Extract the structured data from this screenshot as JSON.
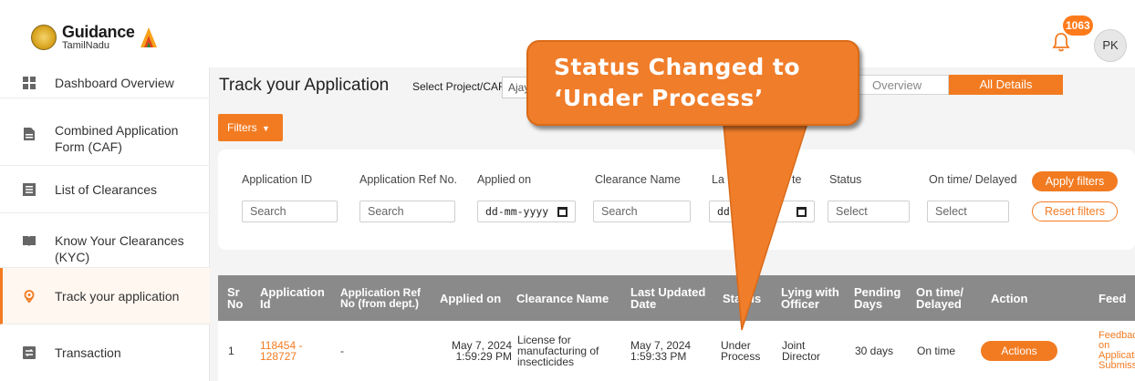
{
  "header": {
    "logo_title": "Guidance",
    "logo_subtitle": "TamilNadu",
    "notification_count": "1063",
    "avatar_initials": "PK"
  },
  "sidebar": {
    "items": [
      {
        "label": "Dashboard Overview",
        "icon": "dashboard-icon"
      },
      {
        "label": "Combined Application Form (CAF)",
        "icon": "document-icon"
      },
      {
        "label": "List of Clearances",
        "icon": "list-icon"
      },
      {
        "label": "Know Your Clearances (KYC)",
        "icon": "book-icon"
      },
      {
        "label": "Track your application",
        "icon": "location-pin-icon",
        "active": true
      },
      {
        "label": "Transaction",
        "icon": "transaction-icon"
      }
    ]
  },
  "main": {
    "title": "Track your Application",
    "select_label": "Select Project/CAF",
    "select_value": "Ajay",
    "tabs": [
      "Overview",
      "All Details"
    ],
    "filters_label": "Filters"
  },
  "filters": {
    "labels": [
      "Application ID",
      "Application Ref No.",
      "Applied on",
      "Clearance Name",
      "La",
      "te",
      "Status",
      "On time/ Delayed"
    ],
    "placeholders": {
      "application_id": "Search",
      "ref_no": "Search",
      "applied_on": "dd-mm-yyyy",
      "clearance_name": "Search",
      "last_updated": "dd",
      "status": "Select",
      "on_time": "Select"
    },
    "apply_label": "Apply filters",
    "reset_label": "Reset filters"
  },
  "table": {
    "headers": [
      "Sr No",
      "Application Id",
      "Application Ref No (from dept.)",
      "Applied on",
      "Clearance Name",
      "Last Updated Date",
      "Sta",
      "us",
      "Lying with Officer",
      "Pending Days",
      "On time/ Delayed",
      "Action",
      "Feed"
    ],
    "row": {
      "sr": "1",
      "app_id": "118454 - 128727",
      "ref_no": "-",
      "applied_on": "May 7, 2024 1:59:29 PM",
      "clearance": "License for manufacturing of insecticides",
      "last_updated": "May 7, 2024 1:59:33 PM",
      "status": "Under Process",
      "officer": "Joint Director",
      "pending": "30 days",
      "on_time": "On time",
      "action": "Actions",
      "feedback": "Feedback on Application Submission"
    }
  },
  "callout": {
    "line1": "Status Changed to",
    "line2": "‘Under Process’"
  },
  "colors": {
    "accent": "#f27b21",
    "table_header": "#8a8a8a",
    "callout": "#f07d2a"
  }
}
